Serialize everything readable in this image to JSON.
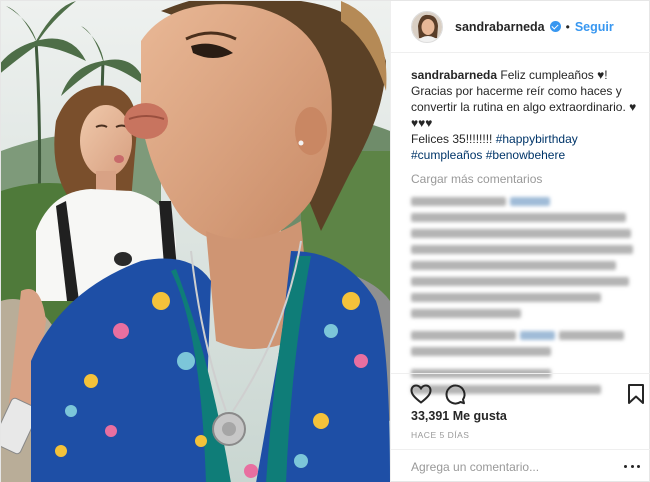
{
  "post": {
    "username": "sandrabarneda",
    "follow_label": "Seguir",
    "separator": "•",
    "caption": {
      "username": "sandrabarneda",
      "text_line1": " Feliz cumpleaños ♥!",
      "text_line2": "Gracias por hacerme reír como haces y",
      "text_line3": "convertir la rutina en algo extraordinario. ♥",
      "text_line4": "♥♥♥",
      "text_line5": "Felices 35!!!!!!!! ",
      "hashtag1": "#happybirthday",
      "hashtag2": "#cumpleaños",
      "hashtag3": "#benowbehere"
    },
    "load_more_comments": "Cargar más comentarios",
    "likes": "33,391 Me gusta",
    "time_ago": "HACE 5 DÍAS",
    "comment_placeholder": "Agrega un comentario..."
  },
  "colors": {
    "link_blue": "#3897f0",
    "hashtag_blue": "#003569",
    "muted_gray": "#999999",
    "text_dark": "#262626"
  },
  "icons": {
    "verified": "verified-badge-icon",
    "like": "heart-icon",
    "comment": "comment-bubble-icon",
    "save": "bookmark-icon",
    "options": "more-options-icon"
  }
}
